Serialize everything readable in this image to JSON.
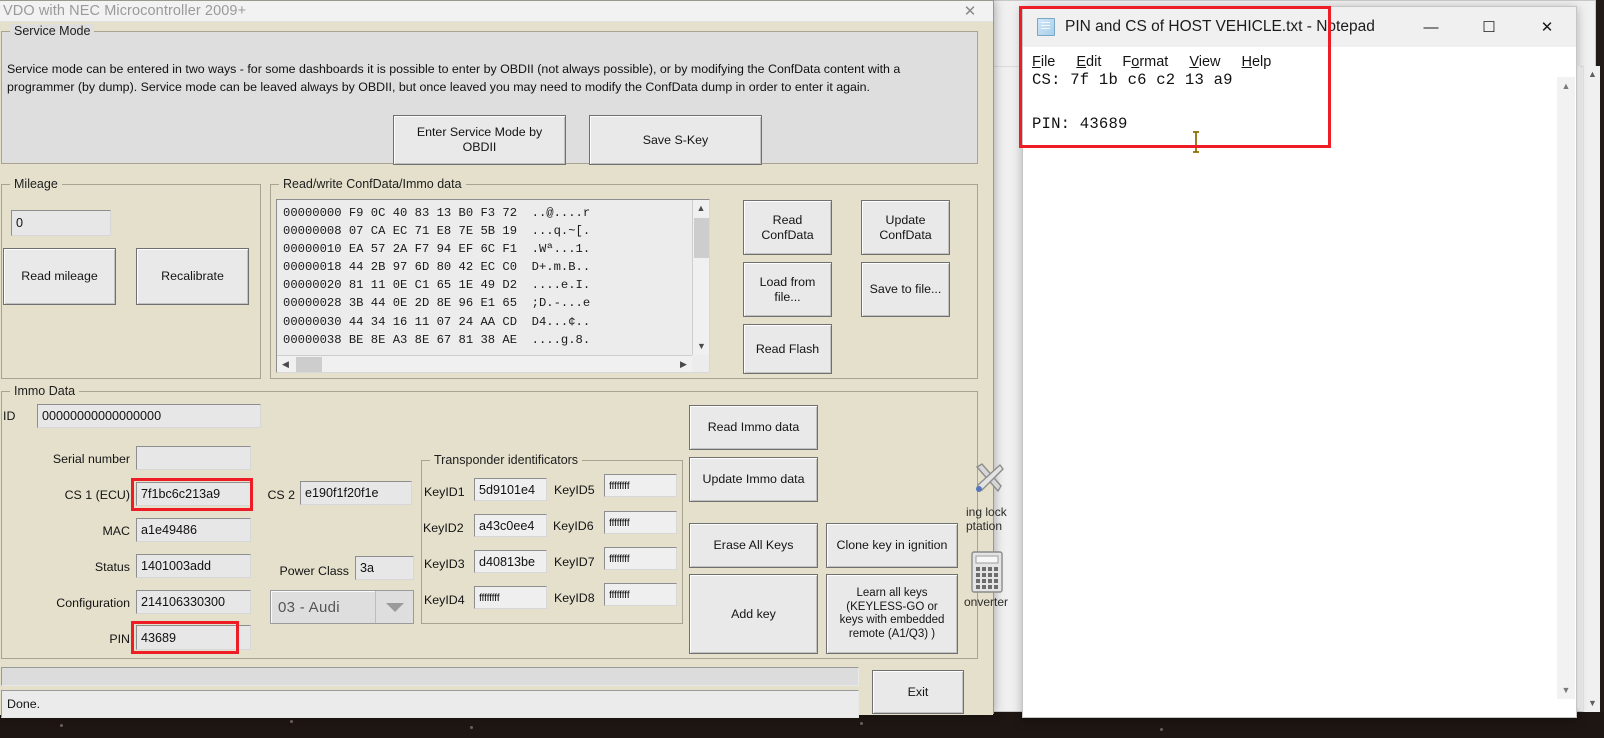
{
  "main_window": {
    "title": "VDO with NEC Microcontroller 2009+",
    "close_glyph": "✕",
    "service_mode": {
      "caption": "Service Mode",
      "description_line1": "Service mode can be entered in two ways - for some dashboards it is possible to enter by OBDII (not always possible), or by modifying the ConfData content with a",
      "description_line2": "programmer (by dump). Service mode can be leaved always by OBDII, but once leaved you may need to modify the ConfData dump in order to enter it again.",
      "enter_service_mode_button": "Enter Service Mode by\nOBDII",
      "save_skey_button": "Save S-Key"
    },
    "mileage": {
      "caption": "Mileage",
      "value": "0",
      "read_button": "Read mileage",
      "recalibrate_button": "Recalibrate"
    },
    "confdata": {
      "caption": "Read/write ConfData/Immo data",
      "hex_lines": [
        "00000000 F9 0C 40 83 13 B0 F3 72  ..@....r",
        "00000008 07 CA EC 71 E8 7E 5B 19  ...q.~[.",
        "00000010 EA 57 2A F7 94 EF 6C F1  .Wª...1.",
        "00000018 44 2B 97 6D 80 42 EC C0  D+.m.B..",
        "00000020 81 11 0E C1 65 1E 49 D2  ....e.I.",
        "00000028 3B 44 0E 2D 8E 96 E1 65  ;D.-...e",
        "00000030 44 34 16 11 07 24 AA CD  D4...¢..",
        "00000038 BE 8E A3 8E 67 81 38 AE  ....g.8."
      ],
      "read_confdata_button": "Read\nConfData",
      "update_confdata_button": "Update\nConfData",
      "load_from_file_button": "Load from\nfile...",
      "save_to_file_button": "Save to file...",
      "read_flash_button": "Read Flash"
    },
    "immo_data": {
      "caption": "Immo Data",
      "id_label": "ID",
      "id_value": "00000000000000000",
      "serial_number_label": "Serial number",
      "serial_number_value": "",
      "cs1_label": "CS 1 (ECU)",
      "cs1_value": "7f1bc6c213a9",
      "cs2_label": "CS 2",
      "cs2_value": "e190f1f20f1e",
      "mac_label": "MAC",
      "mac_value": "a1e49486",
      "status_label": "Status",
      "status_value": "1401003add",
      "power_class_label": "Power Class",
      "power_class_value": "3a",
      "configuration_label": "Configuration",
      "configuration_value": "214106330300",
      "brand_selected": "03 - Audi",
      "pin_label": "PIN",
      "pin_value": "43689",
      "read_immo_button": "Read Immo data",
      "update_immo_button": "Update Immo data",
      "erase_all_keys_button": "Erase All Keys",
      "clone_key_button": "Clone key in ignition",
      "add_key_button": "Add key",
      "learn_all_keys_button": "Learn all keys\n(KEYLESS-GO or\nkeys with embedded\nremote (A1/Q3) )"
    },
    "transponder": {
      "caption": "Transponder identificators",
      "keys": [
        {
          "label": "KeyID1",
          "value": "5d9101e4"
        },
        {
          "label": "KeyID2",
          "value": "a43c0ee4"
        },
        {
          "label": "KeyID3",
          "value": "d40813be"
        },
        {
          "label": "KeyID4",
          "value": "ffffffff"
        },
        {
          "label": "KeyID5",
          "value": "ffffffff"
        },
        {
          "label": "KeyID6",
          "value": "ffffffff"
        },
        {
          "label": "KeyID7",
          "value": "ffffffff"
        },
        {
          "label": "KeyID8",
          "value": "ffffffff"
        }
      ]
    },
    "status_text": "Done.",
    "exit_button": "Exit"
  },
  "notepad": {
    "title": "PIN and CS of HOST VEHICLE.txt - Notepad",
    "minimize_glyph": "—",
    "maximize_glyph": "☐",
    "close_glyph": "✕",
    "menu": [
      "File",
      "Edit",
      "Format",
      "View",
      "Help"
    ],
    "content": "CS: 7f 1b c6 c2 13 a9\n\nPIN: 43689"
  },
  "background_window": {
    "tool_label_1": "ing lock\nptation",
    "tool_label_2": "onverter"
  },
  "colors": {
    "highlight": "#ee1c25",
    "dialog_face": "#e5e0cc",
    "button_face": "#e9e9e9"
  }
}
